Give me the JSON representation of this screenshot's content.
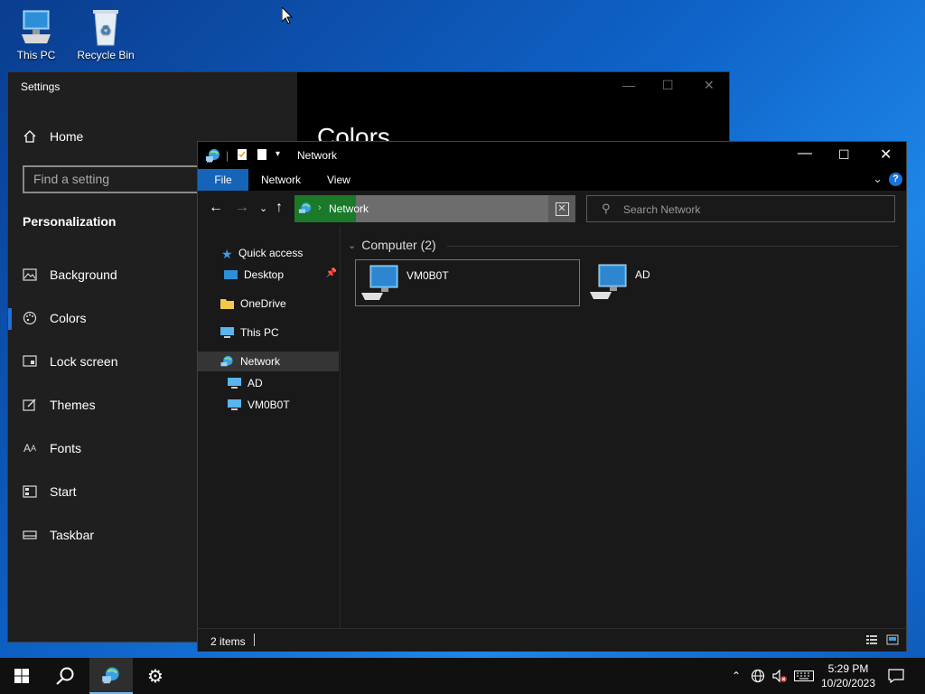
{
  "desktop": {
    "icons": [
      {
        "label": "This PC"
      },
      {
        "label": "Recycle Bin"
      }
    ]
  },
  "settings": {
    "title": "Settings",
    "home_label": "Home",
    "search_placeholder": "Find a setting",
    "group_label": "Personalization",
    "heading": "Colors",
    "nav": [
      {
        "label": "Background",
        "icon": "image-icon"
      },
      {
        "label": "Colors",
        "icon": "palette-icon"
      },
      {
        "label": "Lock screen",
        "icon": "lock-screen-icon"
      },
      {
        "label": "Themes",
        "icon": "themes-icon"
      },
      {
        "label": "Fonts",
        "icon": "fonts-icon"
      },
      {
        "label": "Start",
        "icon": "start-icon"
      },
      {
        "label": "Taskbar",
        "icon": "taskbar-icon"
      }
    ],
    "selected": "Colors"
  },
  "explorer": {
    "title": "Network",
    "ribbon": {
      "file": "File",
      "tabs": [
        "Network",
        "View"
      ]
    },
    "address": {
      "crumb": "Network",
      "search_placeholder": "Search Network"
    },
    "nav_pane": [
      {
        "label": "Quick access",
        "icon": "star-icon"
      },
      {
        "label": "Desktop",
        "icon": "desktop-folder-icon",
        "pinned": true
      },
      {
        "label": "OneDrive",
        "icon": "folder-icon"
      },
      {
        "label": "This PC",
        "icon": "computer-icon"
      },
      {
        "label": "Network",
        "icon": "network-icon",
        "selected": true
      },
      {
        "label": "AD",
        "icon": "computer-icon"
      },
      {
        "label": "VM0B0T",
        "icon": "computer-icon"
      }
    ],
    "group": {
      "title": "Computer (2)",
      "items": [
        {
          "label": "VM0B0T",
          "selected": true
        },
        {
          "label": "AD"
        }
      ]
    },
    "status": {
      "count": "2 items"
    }
  },
  "taskbar": {
    "clock_time": "5:29 PM",
    "clock_date": "10/20/2023"
  },
  "colors": {
    "accent": "#1564b8",
    "address_fill": "#1a7a2a",
    "selection_bar": "#1e6fd9"
  }
}
